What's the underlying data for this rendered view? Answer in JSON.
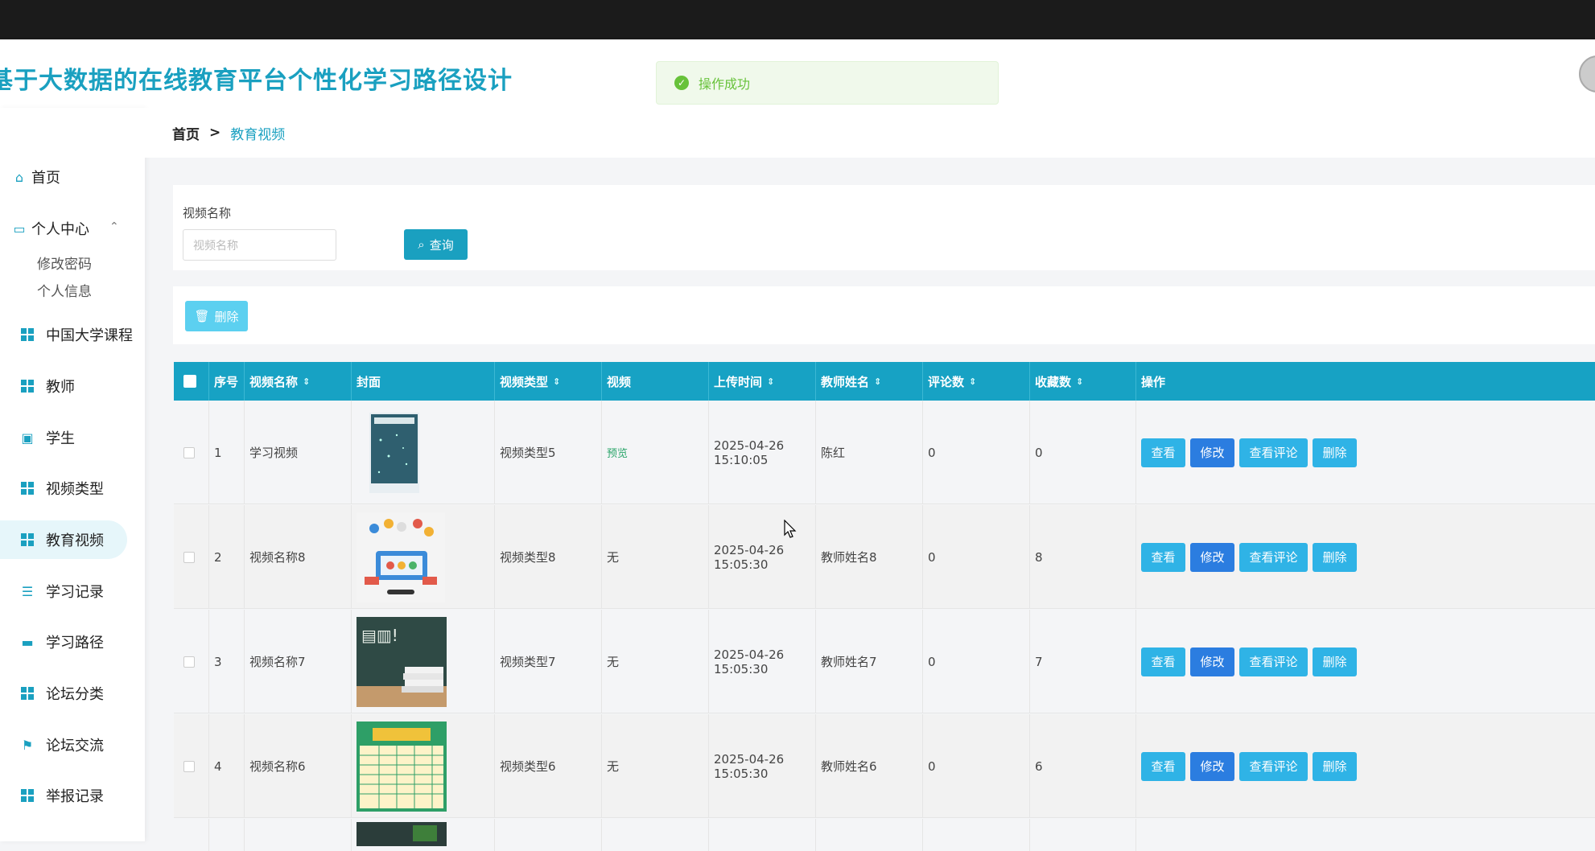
{
  "app": {
    "title": "基于大数据的在线教育平台个性化学习路径设计"
  },
  "toast": {
    "message": "操作成功"
  },
  "sidebar": {
    "home": "首页",
    "personal_center": "个人中心",
    "sub": [
      "修改密码",
      "个人信息"
    ],
    "items": [
      "中国大学课程",
      "教师",
      "学生",
      "视频类型",
      "教育视频",
      "学习记录",
      "学习路径",
      "论坛分类",
      "论坛交流",
      "举报记录"
    ],
    "active": "教育视频"
  },
  "breadcrumb": {
    "home": "首页",
    "sep": ">",
    "current": "教育视频"
  },
  "search": {
    "label": "视频名称",
    "placeholder": "视频名称",
    "button": "查询"
  },
  "actions": {
    "delete": "删除"
  },
  "table": {
    "headers": {
      "index": "序号",
      "name": "视频名称",
      "cover": "封面",
      "type": "视频类型",
      "video": "视频",
      "upload_time": "上传时间",
      "teacher": "教师姓名",
      "comments": "评论数",
      "favorites": "收藏数",
      "ops": "操作"
    },
    "buttons": {
      "view": "查看",
      "edit": "修改",
      "view_comments": "查看评论",
      "delete": "删除"
    },
    "rows": [
      {
        "index": "1",
        "name": "学习视频",
        "type": "视频类型5",
        "video": "预览",
        "upload_time": "2025-04-26 15:10:05",
        "teacher": "陈红",
        "comments": "0",
        "favorites": "0"
      },
      {
        "index": "2",
        "name": "视频名称8",
        "type": "视频类型8",
        "video": "无",
        "upload_time": "2025-04-26 15:05:30",
        "teacher": "教师姓名8",
        "comments": "0",
        "favorites": "8"
      },
      {
        "index": "3",
        "name": "视频名称7",
        "type": "视频类型7",
        "video": "无",
        "upload_time": "2025-04-26 15:05:30",
        "teacher": "教师姓名7",
        "comments": "0",
        "favorites": "7"
      },
      {
        "index": "4",
        "name": "视频名称6",
        "type": "视频类型6",
        "video": "无",
        "upload_time": "2025-04-26 15:05:30",
        "teacher": "教师姓名6",
        "comments": "0",
        "favorites": "6"
      }
    ]
  },
  "colors": {
    "accent": "#1aa0c0",
    "header_bg": "#17a2c4",
    "edit_btn": "#2b7de0",
    "success": "#67c23a"
  },
  "icons": {
    "home": "home-icon",
    "personal": "id-card-icon",
    "grid": "grid-icon",
    "search": "search-icon",
    "trash": "trash-icon",
    "success": "check-circle-icon"
  }
}
